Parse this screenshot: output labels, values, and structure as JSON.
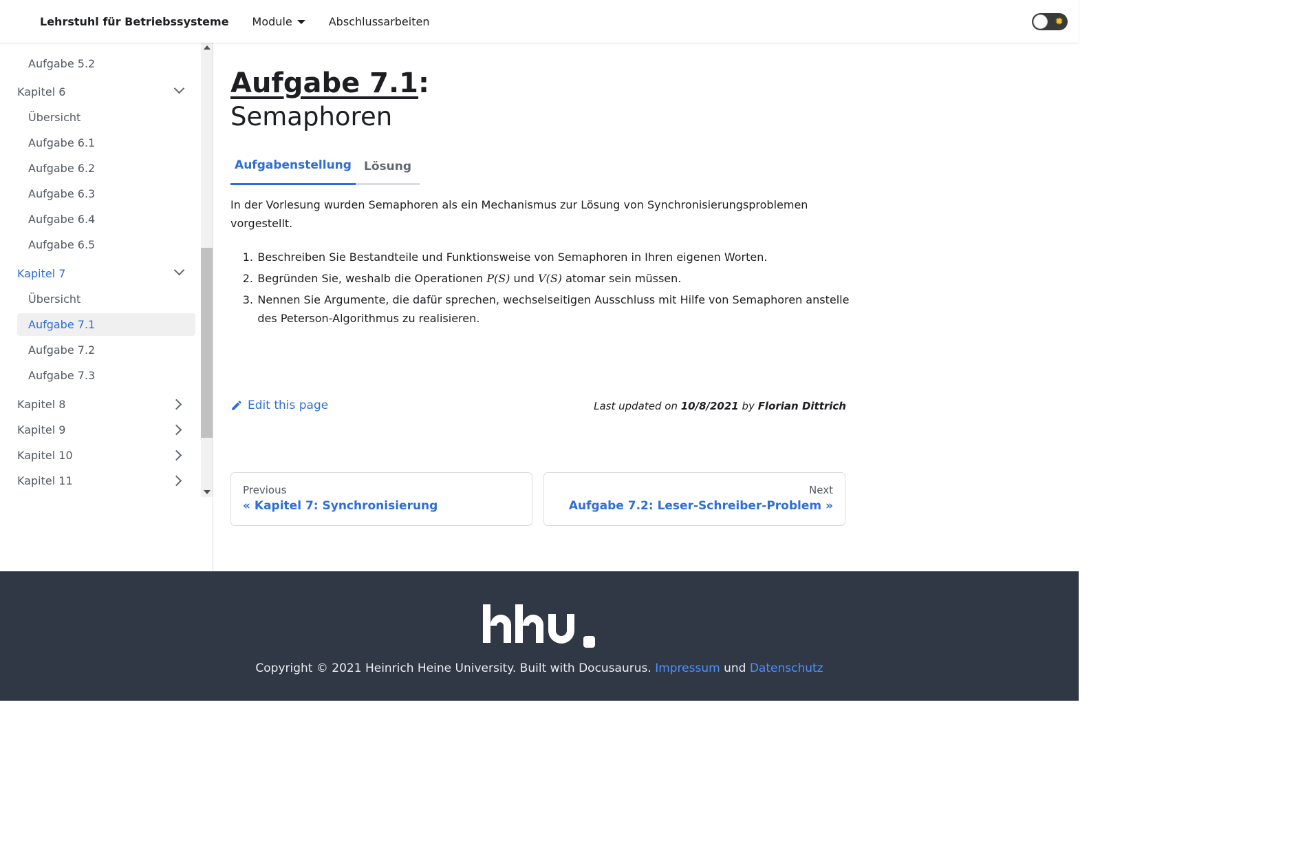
{
  "navbar": {
    "brand": "Lehrstuhl für Betriebssysteme",
    "links": [
      {
        "label": "Module",
        "dropdown": true
      },
      {
        "label": "Abschlussarbeiten",
        "dropdown": false
      }
    ],
    "theme_toggle": {
      "mode": "light",
      "icon": "sun-icon"
    }
  },
  "sidebar": {
    "items": [
      {
        "label": "Aufgabe 5.2",
        "type": "sub",
        "state": "normal"
      },
      {
        "label": "Kapitel 6",
        "type": "category",
        "state": "expanded"
      },
      {
        "label": "Übersicht",
        "type": "sub",
        "state": "normal"
      },
      {
        "label": "Aufgabe 6.1",
        "type": "sub",
        "state": "normal"
      },
      {
        "label": "Aufgabe 6.2",
        "type": "sub",
        "state": "normal"
      },
      {
        "label": "Aufgabe 6.3",
        "type": "sub",
        "state": "normal"
      },
      {
        "label": "Aufgabe 6.4",
        "type": "sub",
        "state": "normal"
      },
      {
        "label": "Aufgabe 6.5",
        "type": "sub",
        "state": "normal"
      },
      {
        "label": "Kapitel 7",
        "type": "category",
        "state": "expanded-active"
      },
      {
        "label": "Übersicht",
        "type": "sub",
        "state": "normal"
      },
      {
        "label": "Aufgabe 7.1",
        "type": "sub",
        "state": "selected"
      },
      {
        "label": "Aufgabe 7.2",
        "type": "sub",
        "state": "normal"
      },
      {
        "label": "Aufgabe 7.3",
        "type": "sub",
        "state": "normal"
      },
      {
        "label": "Kapitel 8",
        "type": "category",
        "state": "collapsed"
      },
      {
        "label": "Kapitel 9",
        "type": "category",
        "state": "collapsed"
      },
      {
        "label": "Kapitel 10",
        "type": "category",
        "state": "collapsed"
      },
      {
        "label": "Kapitel 11",
        "type": "category",
        "state": "collapsed"
      }
    ]
  },
  "main": {
    "title_link": "Aufgabe 7.1",
    "title_colon": ":",
    "subtitle": "Semaphoren",
    "tabs": [
      {
        "label": "Aufgabenstellung",
        "active": true
      },
      {
        "label": "Lösung",
        "active": false
      }
    ],
    "intro": "In der Vorlesung wurden Semaphoren als ein Mechanismus zur Lösung von Synchronisierungsproblemen vorgestellt.",
    "list": [
      {
        "num": "1.",
        "text": "Beschreiben Sie Bestandteile und Funktionsweise von Semaphoren in Ihren eigenen Worten."
      },
      {
        "num": "2.",
        "text_before": "Begründen Sie, weshalb die Operationen ",
        "math1": "P(S)",
        "text_mid": " und ",
        "math2": "V(S)",
        "text_after": " atomar sein müssen."
      },
      {
        "num": "3.",
        "text": "Nennen Sie Argumente, die dafür sprechen, wechselseitigen Ausschluss mit Hilfe von Semaphoren anstelle des Peterson-Algorithmus zu realisieren."
      }
    ],
    "edit_label": "Edit this page",
    "updated": {
      "prefix": "Last updated on ",
      "date": "10/8/2021",
      "by": " by ",
      "author": "Florian Dittrich"
    },
    "pager": {
      "prev": {
        "label": "Previous",
        "title": "« Kapitel 7: Synchronisierung"
      },
      "next": {
        "label": "Next",
        "title": "Aufgabe 7.2: Leser-Schreiber-Problem »"
      }
    }
  },
  "footer": {
    "logo_text": "hhu.",
    "copyright": "Copyright © 2021 Heinrich Heine University. Built with Docusaurus. ",
    "impressum": "Impressum",
    "und": " und ",
    "datenschutz": "Datenschutz"
  },
  "colors": {
    "accent": "#2e6ed6",
    "footer_bg": "#303846",
    "text": "#1c1e21"
  }
}
